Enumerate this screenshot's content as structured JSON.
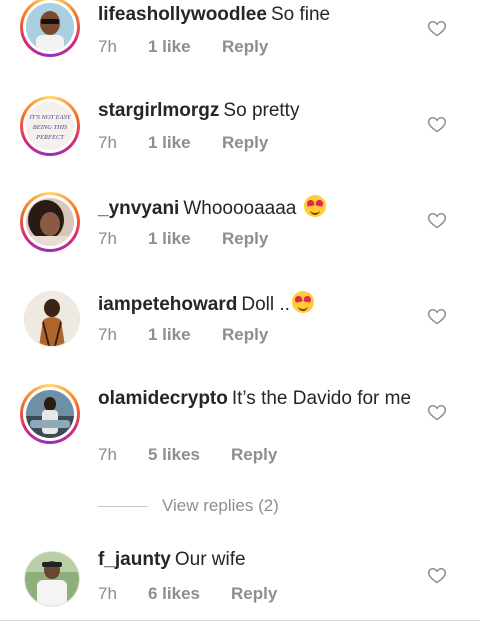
{
  "comments": [
    {
      "username": "lifeashollywoodlee",
      "text": "So fine",
      "time": "7h",
      "likes": "1 like",
      "reply": "Reply",
      "emoji": false,
      "avatar": "man-sunglasses-car"
    },
    {
      "username": "stargirlmorgz",
      "text": "So pretty",
      "time": "7h",
      "likes": "1 like",
      "reply": "Reply",
      "emoji": false,
      "avatar": "text-sticker",
      "avatar_text": "IT'S NOT EASY BEING THIS PERFECT"
    },
    {
      "username": "_ynvyani",
      "text": "Whooooaaaa",
      "time": "7h",
      "likes": "1 like",
      "reply": "Reply",
      "emoji": true,
      "avatar": "woman-selfie"
    },
    {
      "username": "iampetehoward",
      "text": "Doll ..",
      "time": "7h",
      "likes": "1 like",
      "reply": "Reply",
      "emoji": true,
      "avatar": "person-outfit"
    },
    {
      "username": "olamidecrypto",
      "text": "It’s the Davido for me",
      "time": "7h",
      "likes": "5 likes",
      "reply": "Reply",
      "emoji": false,
      "avatar": "man-in-front-of-car"
    },
    {
      "username": "f_jaunty",
      "text": "Our wife",
      "time": "7h",
      "likes": "6 likes",
      "reply": "Reply",
      "emoji": false,
      "avatar": "man-outdoor"
    }
  ],
  "view_replies": "View replies (2)",
  "colors": {
    "meta": "#8e8e8e",
    "username": "#262626",
    "divider": "#dbdbdb"
  },
  "icons": {
    "like": "heart-outline-icon",
    "emoji": "heart-eyes-emoji"
  }
}
